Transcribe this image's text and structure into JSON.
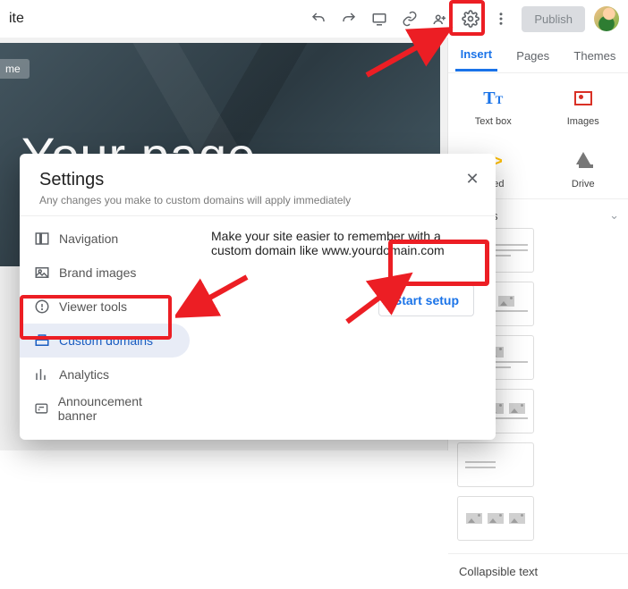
{
  "toolbar": {
    "site_label": "ite",
    "publish_label": "Publish"
  },
  "hero": {
    "home_chip": "me",
    "title": "Your page"
  },
  "side": {
    "tabs": [
      "Insert",
      "Pages",
      "Themes"
    ],
    "quick": {
      "textbox": "Text box",
      "images": "Images",
      "embed": "nbed",
      "drive": "Drive"
    },
    "layouts_label": "Layouts",
    "collapsible": "Collapsible text"
  },
  "modal": {
    "title": "Settings",
    "subtitle": "Any changes you make to custom domains will apply immediately",
    "nav": {
      "navigation": "Navigation",
      "brand_images": "Brand images",
      "viewer_tools": "Viewer tools",
      "custom_domains": "Custom domains",
      "analytics": "Analytics",
      "announcement": "Announcement banner"
    },
    "content": {
      "description": "Make your site easier to remember with a custom domain like www.yourdomain.com",
      "start_label": "Start setup"
    }
  }
}
